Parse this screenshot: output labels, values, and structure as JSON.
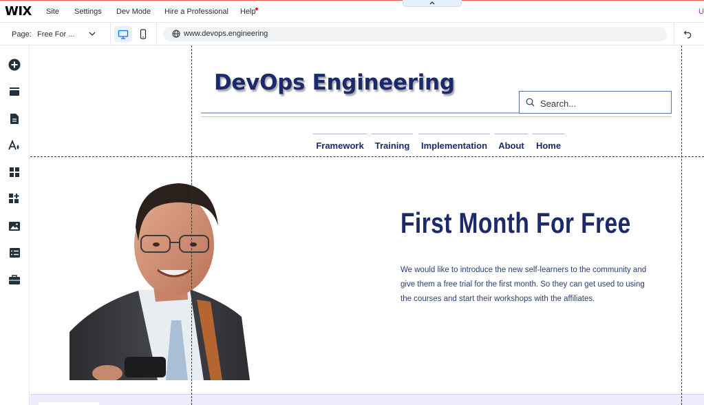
{
  "topbar": {
    "logo": "WIX",
    "menu": [
      "Site",
      "Settings",
      "Dev Mode",
      "Hire a Professional",
      "Help"
    ],
    "collapse_icon": "chevron-up-icon",
    "right_text": "U"
  },
  "pagebar": {
    "page_label": "Page:",
    "page_value": "Free For ...",
    "url": "www.devops.engineering"
  },
  "sidebar": {
    "icons": [
      "add-icon",
      "sections-icon",
      "pages-icon",
      "design-icon",
      "apps-icon",
      "add-apps-icon",
      "media-icon",
      "cms-icon",
      "business-icon"
    ]
  },
  "site": {
    "title": "DevOps Engineering",
    "search_placeholder": "Search...",
    "nav": [
      "Framework",
      "Training",
      "Implementation",
      "About",
      "Home"
    ],
    "hero_title": "First Month For Free",
    "hero_text": "We would like to introduce the new self-learners to the community and give them a free trial for the first month. So they can get used to using the courses and start their workshops with the affiliates."
  },
  "colors": {
    "brand_navy": "#1c2a6b",
    "wix_accent": "#116dff",
    "topbar_border": "#e0594a"
  }
}
